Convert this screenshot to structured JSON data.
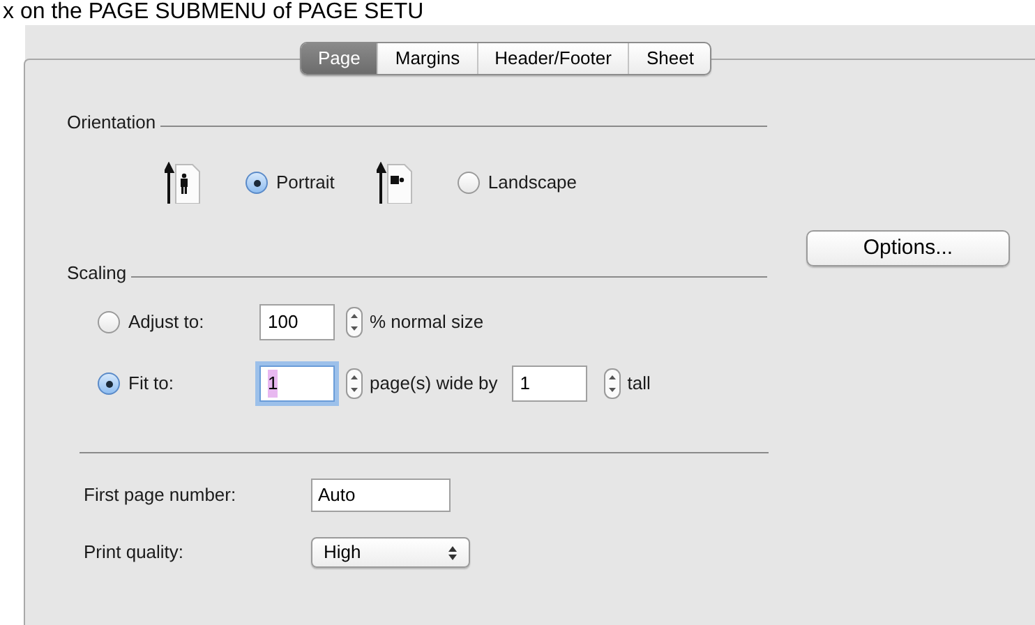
{
  "caption": "x on the PAGE SUBMENU of PAGE SETU",
  "tabs": [
    {
      "label": "Page",
      "selected": true
    },
    {
      "label": "Margins",
      "selected": false
    },
    {
      "label": "Header/Footer",
      "selected": false
    },
    {
      "label": "Sheet",
      "selected": false
    }
  ],
  "orientation": {
    "title": "Orientation",
    "options": [
      {
        "kind": "portrait",
        "label": "Portrait",
        "selected": true
      },
      {
        "kind": "landscape",
        "label": "Landscape",
        "selected": false
      }
    ]
  },
  "options_button": "Options...",
  "scaling": {
    "title": "Scaling",
    "adjust": {
      "label": "Adjust to:",
      "selected": false,
      "value": "100",
      "suffix": "% normal size"
    },
    "fit": {
      "label": "Fit to:",
      "selected": true,
      "wide_value": "1",
      "wide_suffix": "page(s) wide by",
      "tall_value": "1",
      "tall_suffix": "tall"
    }
  },
  "first_page_number": {
    "label": "First page number:",
    "value": "Auto"
  },
  "print_quality": {
    "label": "Print quality:",
    "value": "High"
  }
}
